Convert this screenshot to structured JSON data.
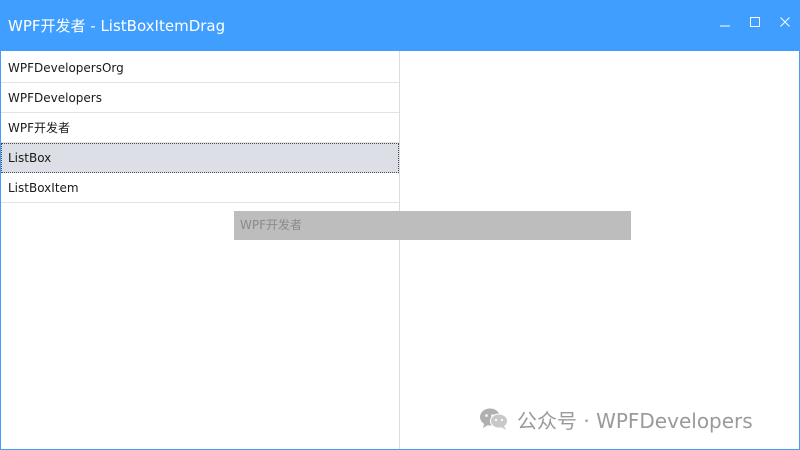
{
  "window": {
    "title": "WPF开发者 - ListBoxItemDrag",
    "titlebar_color": "#409EFF",
    "controls": {
      "minimize_icon": "minimize-icon",
      "maximize_icon": "maximize-icon",
      "close_icon": "close-icon"
    }
  },
  "list": {
    "items": [
      {
        "label": "WPFDevelopersOrg"
      },
      {
        "label": "WPFDevelopers"
      },
      {
        "label": "WPF开发者"
      },
      {
        "label": "ListBox"
      },
      {
        "label": "ListBoxItem"
      }
    ],
    "selected_index": 3
  },
  "drag_ghost": {
    "label": "WPF开发者"
  },
  "watermark": {
    "icon": "wechat-icon",
    "text": "公众号 · WPFDevelopers"
  }
}
